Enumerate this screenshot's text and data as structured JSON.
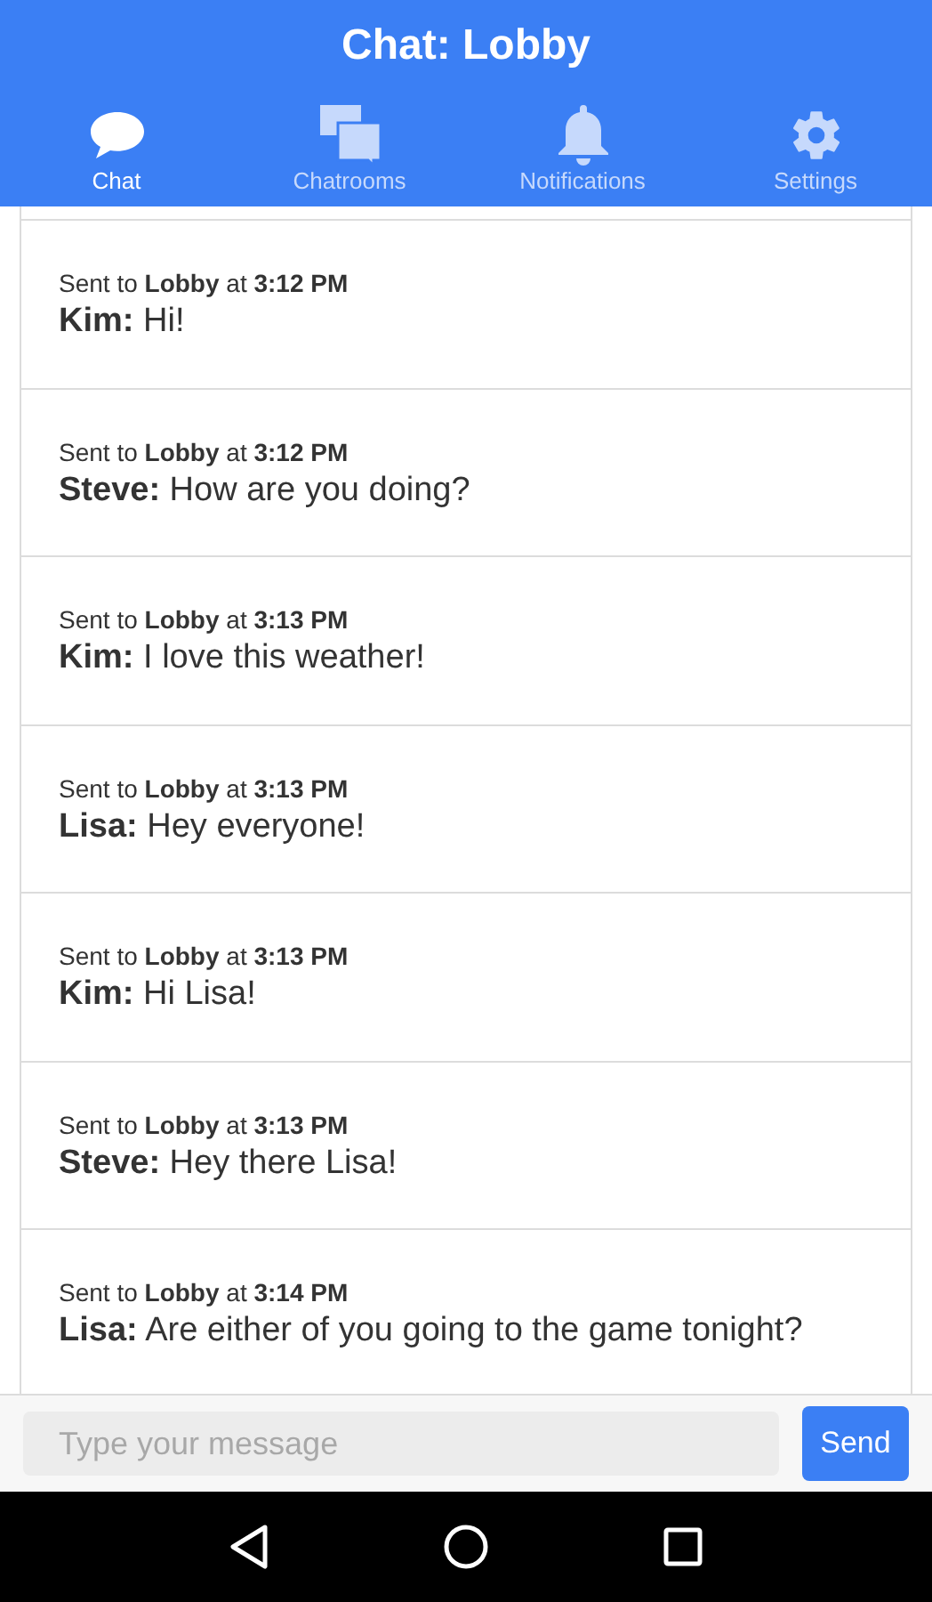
{
  "header": {
    "title": "Chat: Lobby"
  },
  "tabs": [
    {
      "label": "Chat",
      "kind": "bubble",
      "selected": true
    },
    {
      "label": "Chatrooms",
      "kind": "bubbles",
      "selected": false
    },
    {
      "label": "Notifications",
      "kind": "bell",
      "selected": false
    },
    {
      "label": "Settings",
      "kind": "gear",
      "selected": false
    }
  ],
  "messages": [
    {
      "meta": "Sent to **Lobby** at **3:12 PM**",
      "text": "**Kim:** Hi!"
    },
    {
      "meta": "Sent to **Lobby** at **3:12 PM**",
      "text": "**Steve:** How are you doing?"
    },
    {
      "meta": "Sent to **Lobby** at **3:13 PM**",
      "text": "**Kim:** I love this weather!"
    },
    {
      "meta": "Sent to **Lobby** at **3:13 PM**",
      "text": "**Lisa:** Hey everyone!"
    },
    {
      "meta": "Sent to **Lobby** at **3:13 PM**",
      "text": "**Kim:** Hi Lisa!"
    },
    {
      "meta": "Sent to **Lobby** at **3:13 PM**",
      "text": "**Steve:** Hey there Lisa!"
    },
    {
      "meta": "Sent to **Lobby** at **3:14 PM**",
      "text": "**Lisa:** Are either of you going to the game tonight?"
    }
  ],
  "composer": {
    "placeholder": "Type your message",
    "send": "Send"
  }
}
